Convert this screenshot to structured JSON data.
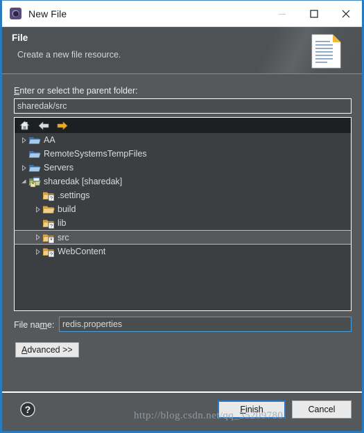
{
  "window": {
    "title": "New File",
    "icon": "wizard-gear-icon",
    "accent_color": "#2a7bbd",
    "background_color": "#56595c",
    "titlebar_background": "#ffffff"
  },
  "titlebar_buttons": [
    {
      "name": "minimize",
      "glyph": "—",
      "enabled": false
    },
    {
      "name": "maximize",
      "glyph": "□",
      "enabled": true
    },
    {
      "name": "close",
      "glyph": "✕",
      "enabled": true
    }
  ],
  "banner": {
    "title": "File",
    "description": "Create a new file resource.",
    "graphic": "new-file-document-icon"
  },
  "form": {
    "parent_folder_label": "Enter or select the parent folder:",
    "parent_folder_label_mnemonic": "E",
    "parent_folder_value": "sharedak/src",
    "parent_folder_placeholder": "",
    "file_name_label": "File name:",
    "file_name_label_mnemonic": "m",
    "file_name_value": "redis.properties",
    "file_name_placeholder": "",
    "advanced_label": "Advanced >>",
    "advanced_mnemonic": "A"
  },
  "tree": {
    "toolbar": [
      {
        "name": "home-icon",
        "tooltip": "Home"
      },
      {
        "name": "back-arrow-icon",
        "tooltip": "Back"
      },
      {
        "name": "forward-arrow-icon",
        "tooltip": "Forward"
      }
    ],
    "selection_color": "#55585b",
    "rows": [
      {
        "label": "AA",
        "indent": 0,
        "twisty": "collapsed",
        "icon": "folder-blue-icon",
        "badge": "none",
        "selected": false
      },
      {
        "label": "RemoteSystemsTempFiles",
        "indent": 0,
        "twisty": "none",
        "icon": "folder-blue-icon",
        "badge": "none",
        "selected": false
      },
      {
        "label": "Servers",
        "indent": 0,
        "twisty": "collapsed",
        "icon": "folder-blue-icon",
        "badge": "none",
        "selected": false
      },
      {
        "label": "sharedak [sharedak]",
        "indent": 0,
        "twisty": "expanded",
        "icon": "project-icon",
        "badge": "asterisk",
        "selected": false
      },
      {
        "label": ".settings",
        "indent": 1,
        "twisty": "none",
        "icon": "folder-yellow-icon",
        "badge": "question",
        "selected": false
      },
      {
        "label": "build",
        "indent": 1,
        "twisty": "collapsed",
        "icon": "folder-yellow-icon",
        "badge": "none",
        "selected": false
      },
      {
        "label": "lib",
        "indent": 1,
        "twisty": "none",
        "icon": "folder-yellow-icon",
        "badge": "question",
        "selected": false
      },
      {
        "label": "src",
        "indent": 1,
        "twisty": "collapsed",
        "icon": "folder-yellow-icon",
        "badge": "asterisk",
        "selected": true
      },
      {
        "label": "WebContent",
        "indent": 1,
        "twisty": "collapsed",
        "icon": "folder-yellow-icon",
        "badge": "question",
        "selected": false
      }
    ]
  },
  "footer": {
    "help_glyph": "?",
    "finish_label": "Finish",
    "finish_mnemonic": "F",
    "cancel_label": "Cancel",
    "is_default_button": "Finish"
  },
  "watermark": {
    "text": "http://blog.csdn.net/qq_35209780"
  }
}
